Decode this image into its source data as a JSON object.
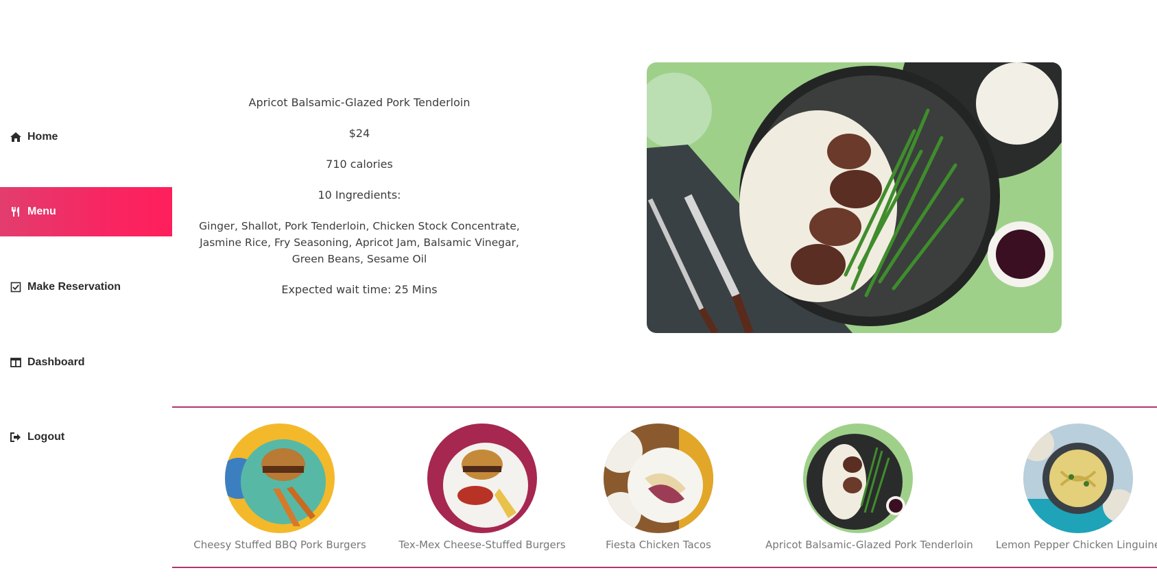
{
  "sidebar": {
    "items": [
      {
        "label": "Home",
        "icon": "home-icon"
      },
      {
        "label": "Menu",
        "icon": "utensils-icon",
        "active": true
      },
      {
        "label": "Make Reservation",
        "icon": "checkbox-icon"
      },
      {
        "label": "Dashboard",
        "icon": "columns-icon"
      },
      {
        "label": "Logout",
        "icon": "sign-out-icon"
      }
    ],
    "active_color": "#f72662"
  },
  "dish": {
    "name": "Apricot Balsamic-Glazed Pork Tenderloin",
    "price": "$24",
    "calories": "710 calories",
    "ingredients_heading": "10 Ingredients:",
    "ingredients": "Ginger, Shallot, Pork Tenderloin, Chicken Stock Concentrate, Jasmine Rice, Fry Seasoning, Apricot Jam, Balsamic Vinegar, Green Beans, Sesame Oil",
    "wait_time": "Expected wait time: 25 Mins"
  },
  "carousel": {
    "items": [
      {
        "label": "Cheesy Stuffed BBQ Pork Burgers"
      },
      {
        "label": "Tex-Mex Cheese-Stuffed Burgers"
      },
      {
        "label": "Fiesta Chicken Tacos"
      },
      {
        "label": "Apricot Balsamic-Glazed Pork Tenderloin"
      },
      {
        "label": "Lemon Pepper Chicken Linguine"
      }
    ],
    "rule_color": "#b0356b"
  }
}
